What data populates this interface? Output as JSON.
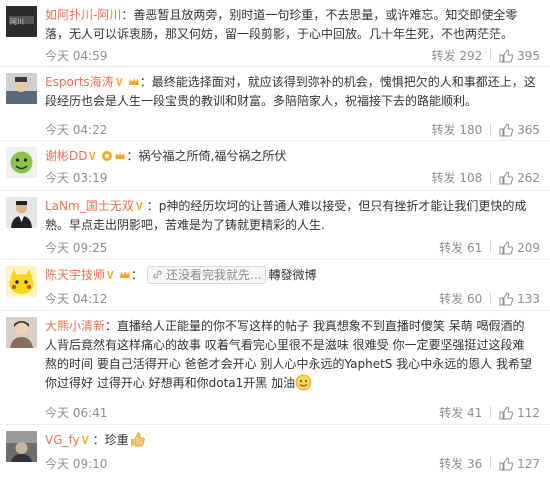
{
  "comments": [
    {
      "username": "如阿扑川-阿川",
      "text": "善恶暂且放两旁，别时道一句珍重，不去思量，或许难忘。知交即使全零落，无人可以诉衷肠，那又何妨，留一段剪影，于心中回放。几十年生死，不也两茫茫。",
      "time": "今天 04:59",
      "repost_label": "转发",
      "reposts": "292",
      "likes": "395"
    },
    {
      "username": "Esports海涛",
      "text": "最终能选择面对，就应该得到弥补的机会，愧惧把欠的人和事都还上，这段经历也会是人生一段宝贵的教训和财富。多陪陪家人，祝福接下去的路能顺利。",
      "time": "今天 04:22",
      "repost_label": "转发",
      "reposts": "180",
      "likes": "365"
    },
    {
      "username": "谢彬DD",
      "text": "祸兮福之所倚,福兮祸之所伏",
      "time": "今天 03:19",
      "repost_label": "转发",
      "reposts": "108",
      "likes": "262"
    },
    {
      "username": "LaNm_国士无双",
      "text": "p神的经历坎坷的让普通人难以接受，但只有挫折才能让我们更快的成熟。早点走出阴影吧，苦难是为了铸就更精彩的人生.",
      "time": "今天 09:25",
      "repost_label": "转发",
      "reposts": "61",
      "likes": "209"
    },
    {
      "username": "陈天宇技师",
      "link_text": "还没看完我就先...",
      "text": "轉發微博",
      "time": "今天 04:12",
      "repost_label": "转发",
      "reposts": "60",
      "likes": "133"
    },
    {
      "username": "大熊小清新",
      "text": "直播给人正能量的你不写这样的帖子 我真想象不到直播时傻笑 呆萌 喝假酒的人背后竟然有这样痛心的故事 叹着气看完心里很不是滋味 很难受 你一定要坚强挺过这段难熬的时间 要自己活得开心 爸爸才会开心 别人心中永远的YaphetS 我心中永远的恩人 我希望你过得好 过得开心 好想再和你dota1开黑 加油",
      "time": "今天 06:41",
      "repost_label": "转发",
      "reposts": "41",
      "likes": "112"
    },
    {
      "username": "VG_fy",
      "text": "珍重",
      "time": "今天 09:10",
      "repost_label": "转发",
      "reposts": "36",
      "likes": "127"
    }
  ],
  "colors": {
    "username": "#eb7350",
    "text": "#333333",
    "meta": "#8e8e8e",
    "vip_badge": "#f5a623",
    "separator": "#ececec"
  }
}
